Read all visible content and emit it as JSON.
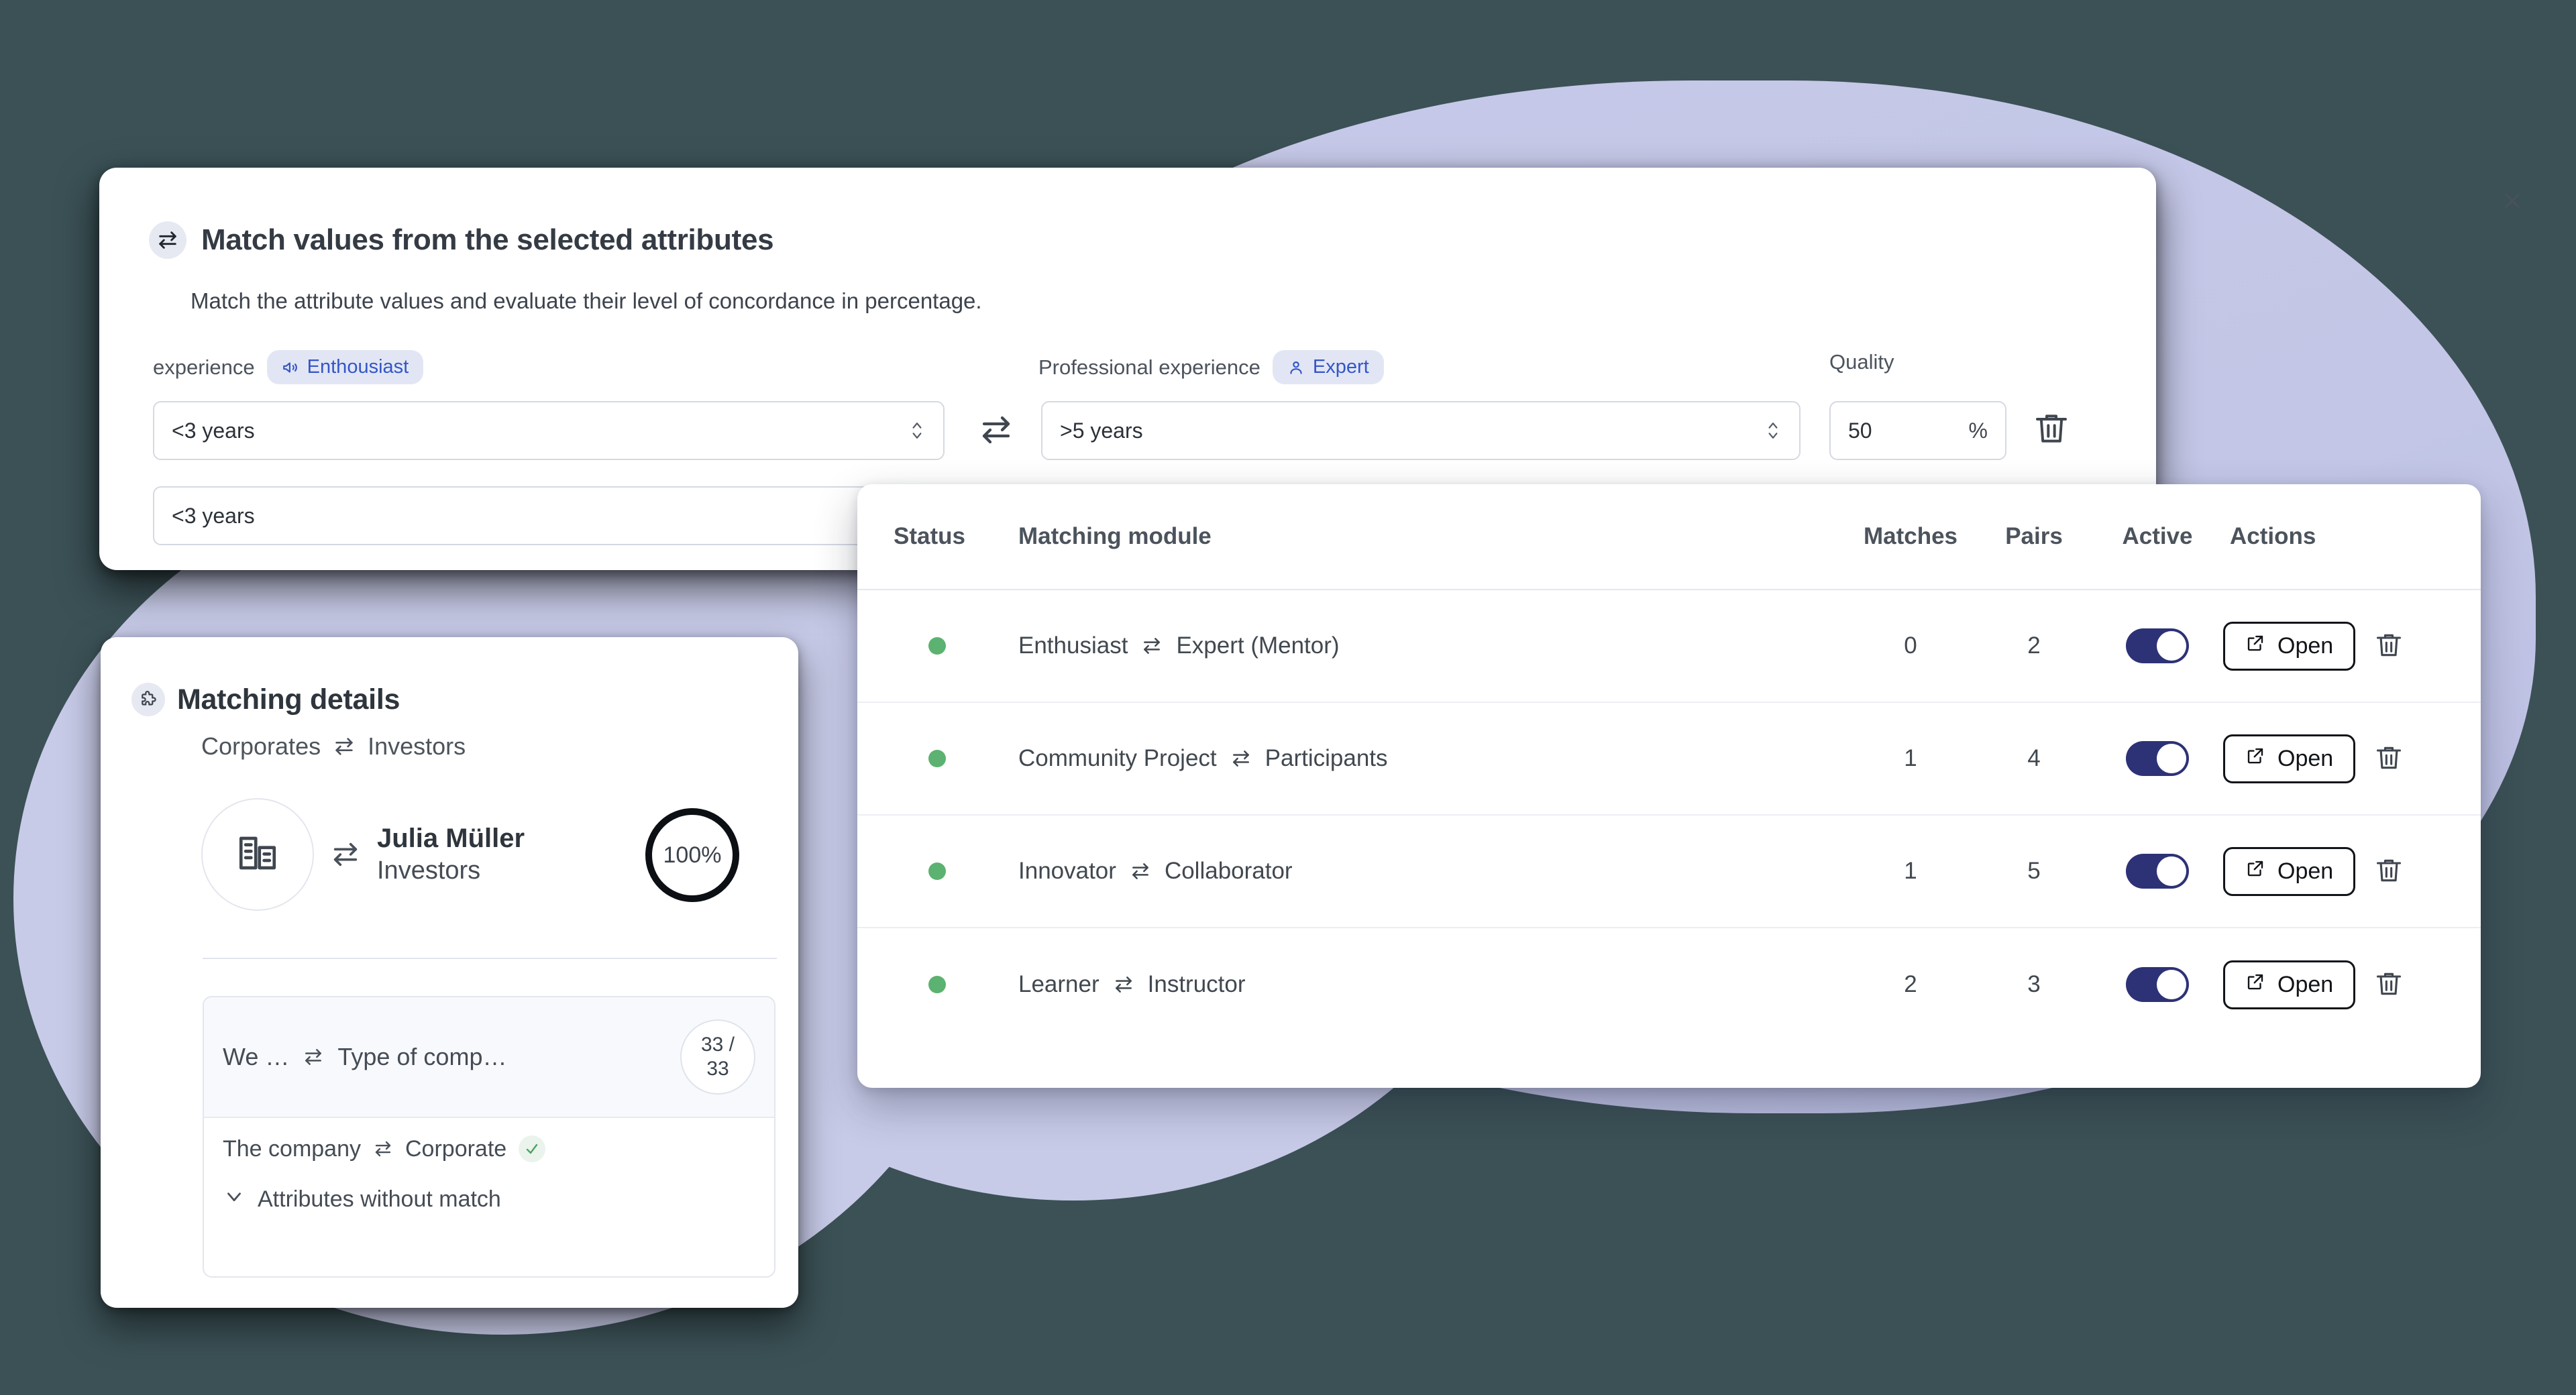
{
  "colors": {
    "background": "#3b5156",
    "blob": "#c8cbe8",
    "accent_blue": "#3456c6",
    "toggle_on": "#2d3276",
    "status_green": "#5cb270"
  },
  "modal": {
    "title": "Match values from the selected attributes",
    "subtitle": "Match the attribute values and evaluate their level of concordance in percentage.",
    "close_label": "×",
    "title_icon": "swap-arrows-icon",
    "left": {
      "label": "experience",
      "tag": "Enthousiast",
      "tag_icon": "megaphone-icon",
      "select_value": "<3 years",
      "select_value_2": "<3 years"
    },
    "right": {
      "label": "Professional experience",
      "tag": "Expert",
      "tag_icon": "person-icon",
      "select_value": ">5 years"
    },
    "quality": {
      "label": "Quality",
      "value": "50",
      "unit": "%"
    }
  },
  "table": {
    "columns": [
      "Status",
      "Matching module",
      "Matches",
      "Pairs",
      "Active",
      "Actions"
    ],
    "open_label": "Open",
    "rows": [
      {
        "status": "active",
        "left": "Enthusiast",
        "right": "Expert (Mentor)",
        "matches": "0",
        "pairs": "2",
        "active": true
      },
      {
        "status": "active",
        "left": "Community Project",
        "right": "Participants",
        "matches": "1",
        "pairs": "4",
        "active": true
      },
      {
        "status": "active",
        "left": "Innovator",
        "right": "Collaborator",
        "matches": "1",
        "pairs": "5",
        "active": true
      },
      {
        "status": "active",
        "left": "Learner",
        "right": "Instructor",
        "matches": "2",
        "pairs": "3",
        "active": true
      }
    ]
  },
  "details": {
    "title": "Matching details",
    "subtitle_left": "Corporates",
    "subtitle_right": "Investors",
    "person_name": "Julia Müller",
    "person_role": "Investors",
    "percent": "100%",
    "attribute_top_left": "We …",
    "attribute_top_right": "Type of comp…",
    "ratio_numerator": "33 /",
    "ratio_denominator": "33",
    "attribute_row_left": "The company",
    "attribute_row_right": "Corporate",
    "expand_label": "Attributes without match"
  }
}
